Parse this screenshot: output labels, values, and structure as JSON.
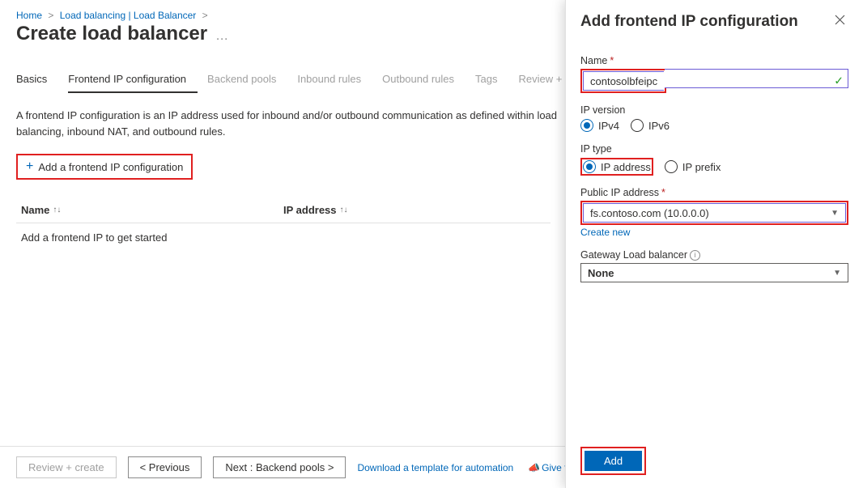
{
  "breadcrumb": {
    "home": "Home",
    "path1": "Load balancing | Load Balancer"
  },
  "page": {
    "title": "Create load balancer"
  },
  "tabs": {
    "basics": "Basics",
    "frontend": "Frontend IP configuration",
    "backend": "Backend pools",
    "inbound": "Inbound rules",
    "outbound": "Outbound rules",
    "tags": "Tags",
    "review": "Review + create"
  },
  "description": "A frontend IP configuration is an IP address used for inbound and/or outbound communication as defined within load balancing, inbound NAT, and outbound rules.",
  "add_btn": "Add a frontend IP configuration",
  "table": {
    "col_name": "Name",
    "col_ip": "IP address",
    "empty": "Add a frontend IP to get started"
  },
  "footer": {
    "review": "Review + create",
    "previous": "< Previous",
    "next": "Next : Backend pools >",
    "template_link": "Download a template for automation",
    "feedback": "Give feedback"
  },
  "panel": {
    "title": "Add frontend IP configuration",
    "name_label": "Name",
    "name_value": "contosolbfeipc",
    "ip_version_label": "IP version",
    "ipv4": "IPv4",
    "ipv6": "IPv6",
    "ip_type_label": "IP type",
    "ip_address": "IP address",
    "ip_prefix": "IP prefix",
    "pub_ip_label": "Public IP address",
    "pub_ip_value": "fs.contoso.com (10.0.0.0)",
    "create_new": "Create new",
    "gateway_label": "Gateway Load balancer",
    "gateway_value": "None",
    "add": "Add"
  }
}
